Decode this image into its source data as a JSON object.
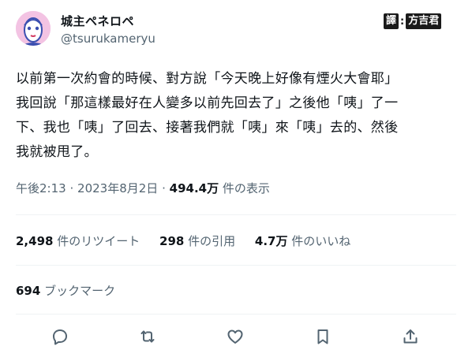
{
  "author": {
    "display_name": "城主ペネロペ",
    "handle": "@tsurukameryu"
  },
  "watermark": {
    "label_a": "譯",
    "separator": ":",
    "label_b": "方吉君"
  },
  "tweet": {
    "lines": [
      "以前第一次約會的時候、對方說「今天晚上好像有煙火大會耶」",
      "我回說「那這樣最好在人變多以前先回去了」之後他「咦」了一",
      "下、我也「咦」了回去、接著我們就「咦」來「咦」去的、然後",
      "我就被甩了。"
    ],
    "time": "午後2:13",
    "dot": "·",
    "date": "2023年8月2日",
    "views": "494.4万",
    "views_label": "件の表示"
  },
  "stats": {
    "retweets": "2,498",
    "retweets_label": "件のリツイート",
    "quotes": "298",
    "quotes_label": "件の引用",
    "likes": "4.7万",
    "likes_label": "件のいいね",
    "bookmarks": "694",
    "bookmarks_label": "ブックマーク"
  },
  "icons": {
    "reply": "reply-icon",
    "retweet": "retweet-icon",
    "like": "like-icon",
    "bookmark": "bookmark-icon",
    "share": "share-icon"
  },
  "colors": {
    "text": "#0f1419",
    "secondary": "#536471",
    "divider": "#eff3f4",
    "avatar_bg": "#f3c3e3"
  }
}
